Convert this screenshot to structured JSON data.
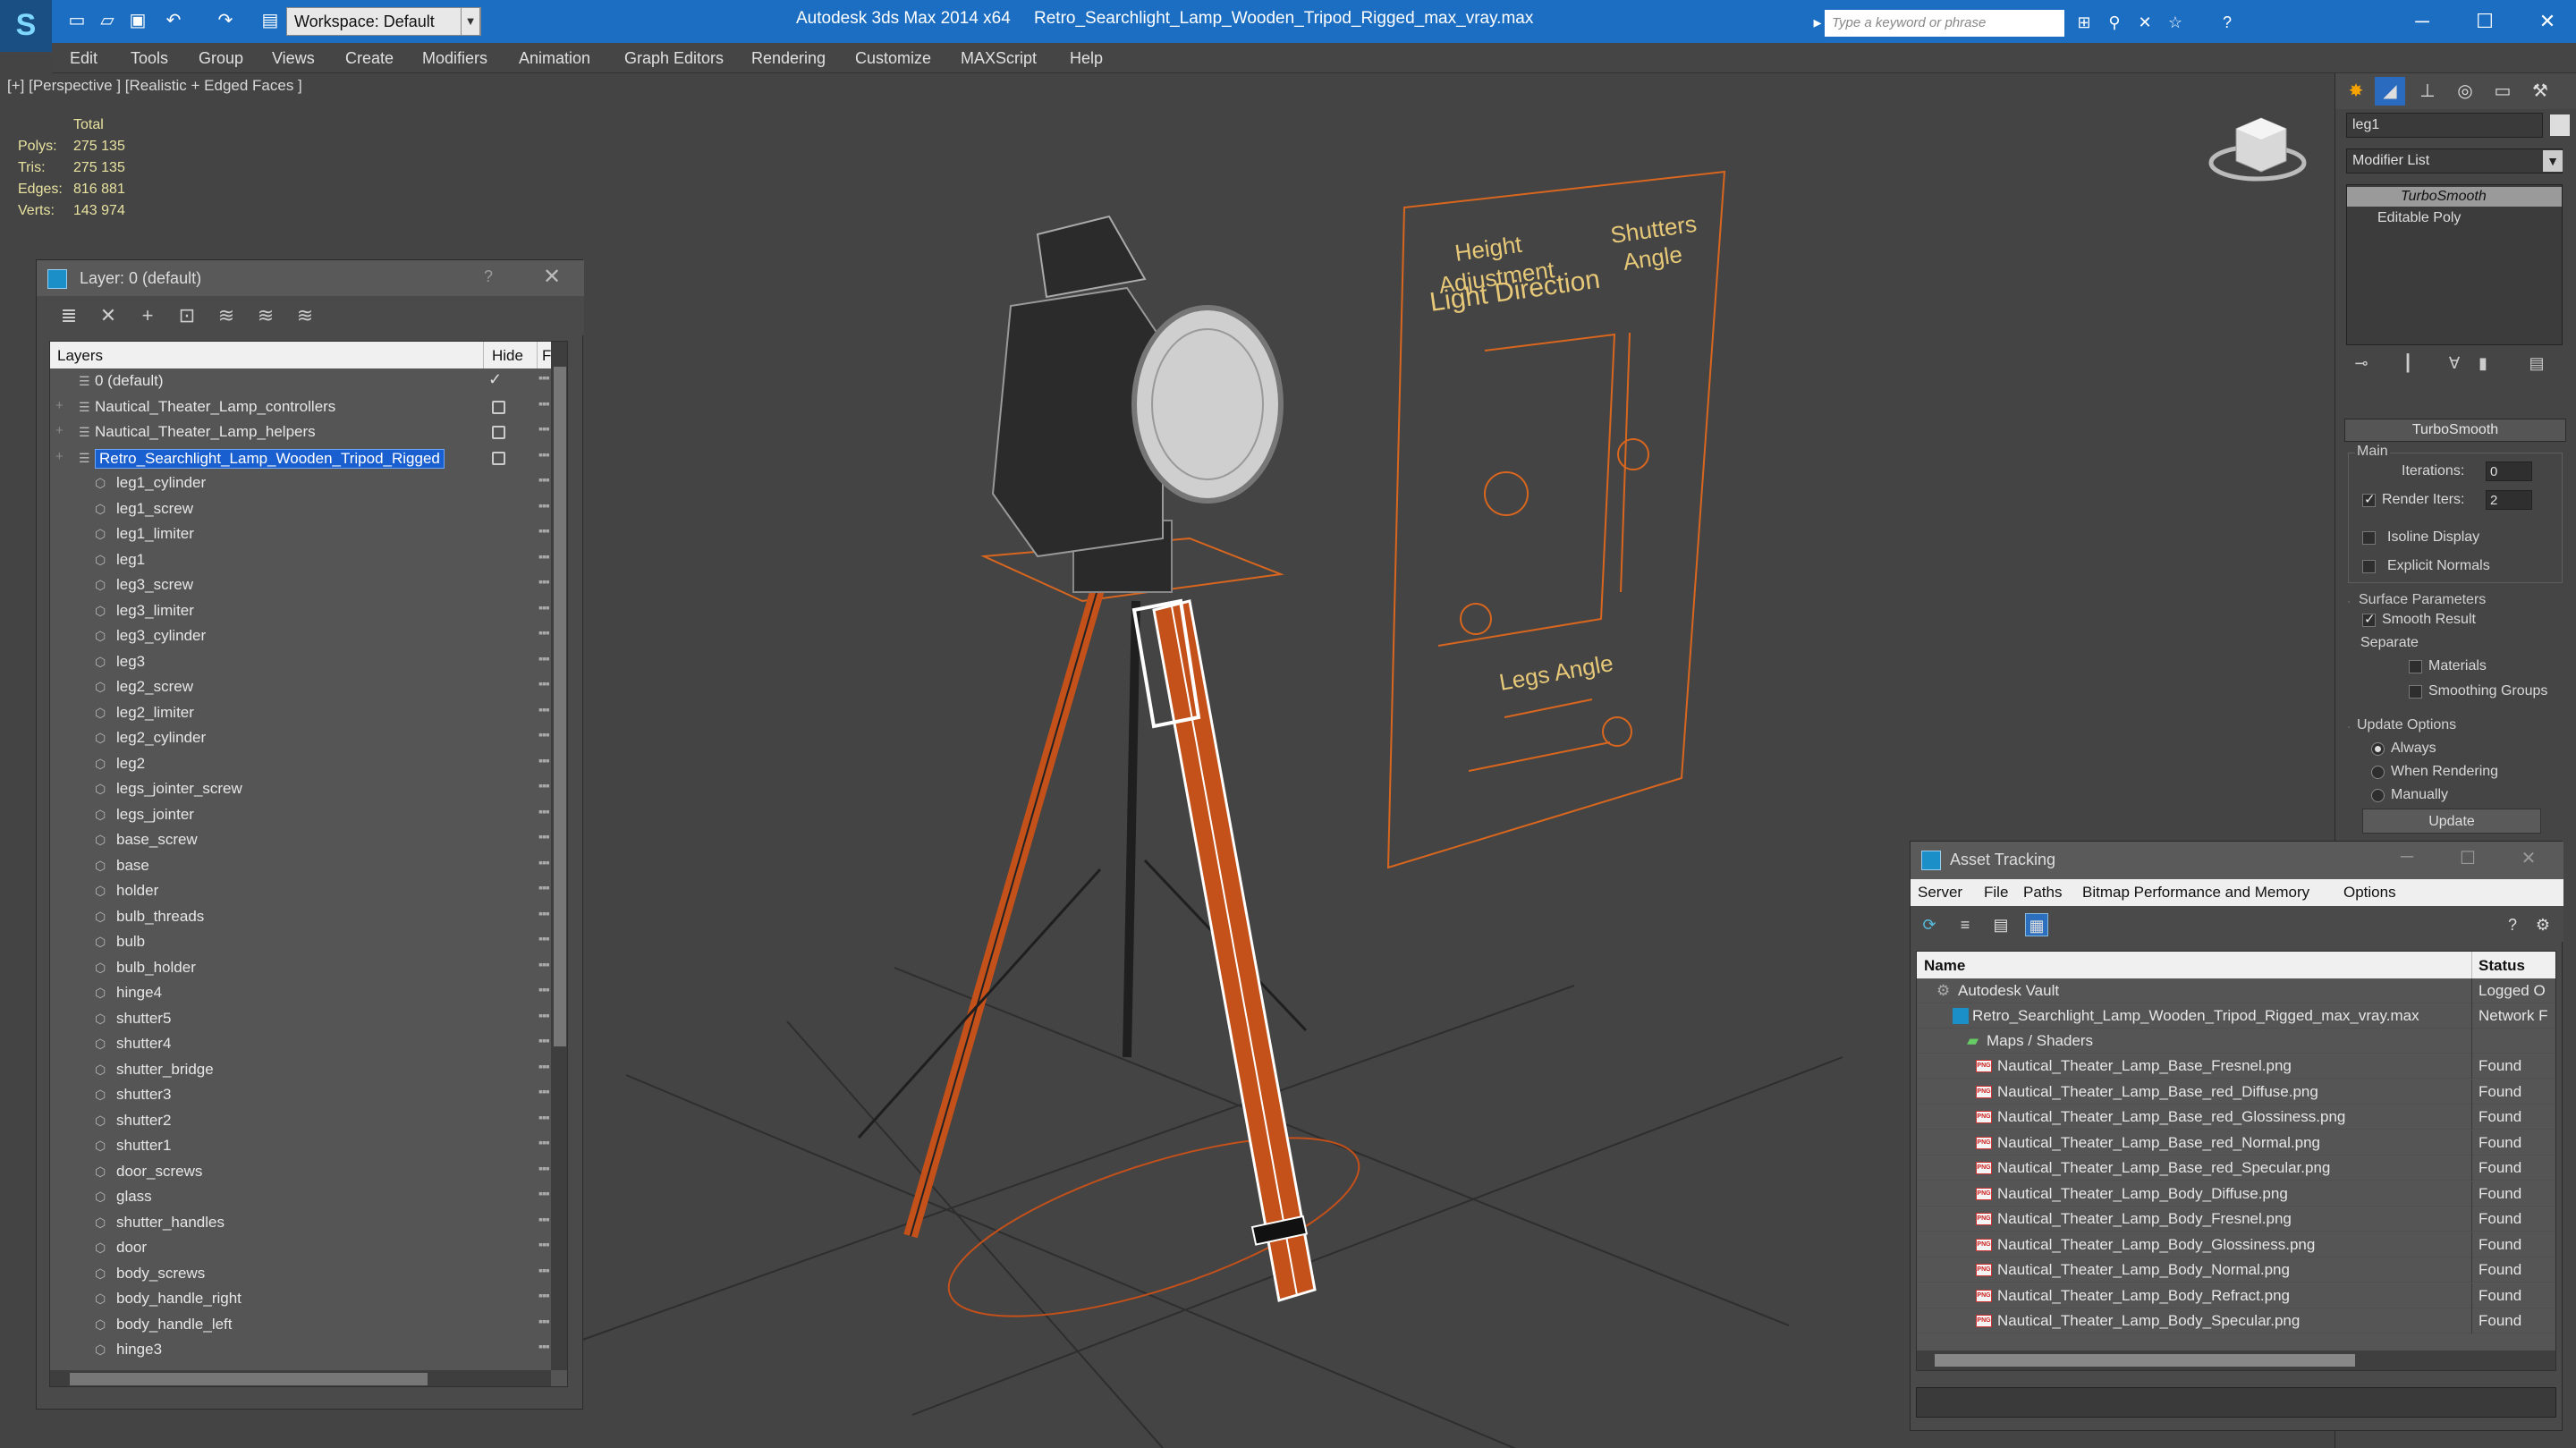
{
  "app": {
    "logo": "S",
    "title": "Autodesk 3ds Max  2014 x64",
    "file": "Retro_Searchlight_Lamp_Wooden_Tripod_Rigged_max_vray.max",
    "workspace": "Workspace: Default",
    "search_placeholder": "Type a keyword or phrase"
  },
  "menu": [
    "Edit",
    "Tools",
    "Group",
    "Views",
    "Create",
    "Modifiers",
    "Animation",
    "Graph Editors",
    "Rendering",
    "Customize",
    "MAXScript",
    "Help"
  ],
  "viewport": {
    "label": "[+] [Perspective ] [Realistic + Edged Faces ]",
    "stats_header": "Total",
    "stats": [
      {
        "k": "Polys:",
        "v": "275 135"
      },
      {
        "k": "Tris:",
        "v": "275 135"
      },
      {
        "k": "Edges:",
        "v": "816 881"
      },
      {
        "k": "Verts:",
        "v": "143 974"
      }
    ],
    "controls": {
      "height": "Height",
      "adjustment": "Adjustment",
      "light_direction": "Light Direction",
      "shutters": "Shutters",
      "angle": "Angle",
      "legs_angle": "Legs Angle"
    },
    "accent_color": "#d9661e"
  },
  "layers": {
    "title": "Layer: 0 (default)",
    "col_layers": "Layers",
    "col_hide": "Hide",
    "col_f": "F",
    "top": [
      {
        "name": "0 (default)",
        "current": true
      },
      {
        "name": "Nautical_Theater_Lamp_controllers"
      },
      {
        "name": "Nautical_Theater_Lamp_helpers"
      },
      {
        "name": "Retro_Searchlight_Lamp_Wooden_Tripod_Rigged",
        "selected": true
      }
    ],
    "children": [
      "leg1_cylinder",
      "leg1_screw",
      "leg1_limiter",
      "leg1",
      "leg3_screw",
      "leg3_limiter",
      "leg3_cylinder",
      "leg3",
      "leg2_screw",
      "leg2_limiter",
      "leg2_cylinder",
      "leg2",
      "legs_jointer_screw",
      "legs_jointer",
      "base_screw",
      "base",
      "holder",
      "bulb_threads",
      "bulb",
      "bulb_holder",
      "hinge4",
      "shutter5",
      "shutter4",
      "shutter_bridge",
      "shutter3",
      "shutter2",
      "shutter1",
      "door_screws",
      "glass",
      "shutter_handles",
      "door",
      "body_screws",
      "body_handle_right",
      "body_handle_left",
      "hinge3"
    ]
  },
  "command_panel": {
    "object_name": "leg1",
    "modifier_list": "Modifier List",
    "stack": [
      "TurboSmooth",
      "Editable Poly"
    ],
    "rollout": "TurboSmooth",
    "main": "Main",
    "iterations_label": "Iterations:",
    "iterations": "0",
    "render_iters_label": "Render Iters:",
    "render_iters": "2",
    "isoline": "Isoline Display",
    "explicit": "Explicit Normals",
    "surface": "Surface Parameters",
    "smooth_result": "Smooth Result",
    "separate": "Separate",
    "materials": "Materials",
    "smoothing_groups": "Smoothing Groups",
    "update_options": "Update Options",
    "always": "Always",
    "when_rendering": "When Rendering",
    "manually": "Manually",
    "update": "Update"
  },
  "asset_tracking": {
    "title": "Asset Tracking",
    "menu": [
      "Server",
      "File",
      "Paths",
      "Bitmap Performance and Memory",
      "Options"
    ],
    "col_name": "Name",
    "col_status": "Status",
    "vault": {
      "name": "Autodesk Vault",
      "status": "Logged O"
    },
    "file": {
      "name": "Retro_Searchlight_Lamp_Wooden_Tripod_Rigged_max_vray.max",
      "status": "Network F"
    },
    "maps": "Maps / Shaders",
    "files": [
      {
        "name": "Nautical_Theater_Lamp_Base_Fresnel.png",
        "status": "Found"
      },
      {
        "name": "Nautical_Theater_Lamp_Base_red_Diffuse.png",
        "status": "Found"
      },
      {
        "name": "Nautical_Theater_Lamp_Base_red_Glossiness.png",
        "status": "Found"
      },
      {
        "name": "Nautical_Theater_Lamp_Base_red_Normal.png",
        "status": "Found"
      },
      {
        "name": "Nautical_Theater_Lamp_Base_red_Specular.png",
        "status": "Found"
      },
      {
        "name": "Nautical_Theater_Lamp_Body_Diffuse.png",
        "status": "Found"
      },
      {
        "name": "Nautical_Theater_Lamp_Body_Fresnel.png",
        "status": "Found"
      },
      {
        "name": "Nautical_Theater_Lamp_Body_Glossiness.png",
        "status": "Found"
      },
      {
        "name": "Nautical_Theater_Lamp_Body_Normal.png",
        "status": "Found"
      },
      {
        "name": "Nautical_Theater_Lamp_Body_Refract.png",
        "status": "Found"
      },
      {
        "name": "Nautical_Theater_Lamp_Body_Specular.png",
        "status": "Found"
      }
    ]
  }
}
